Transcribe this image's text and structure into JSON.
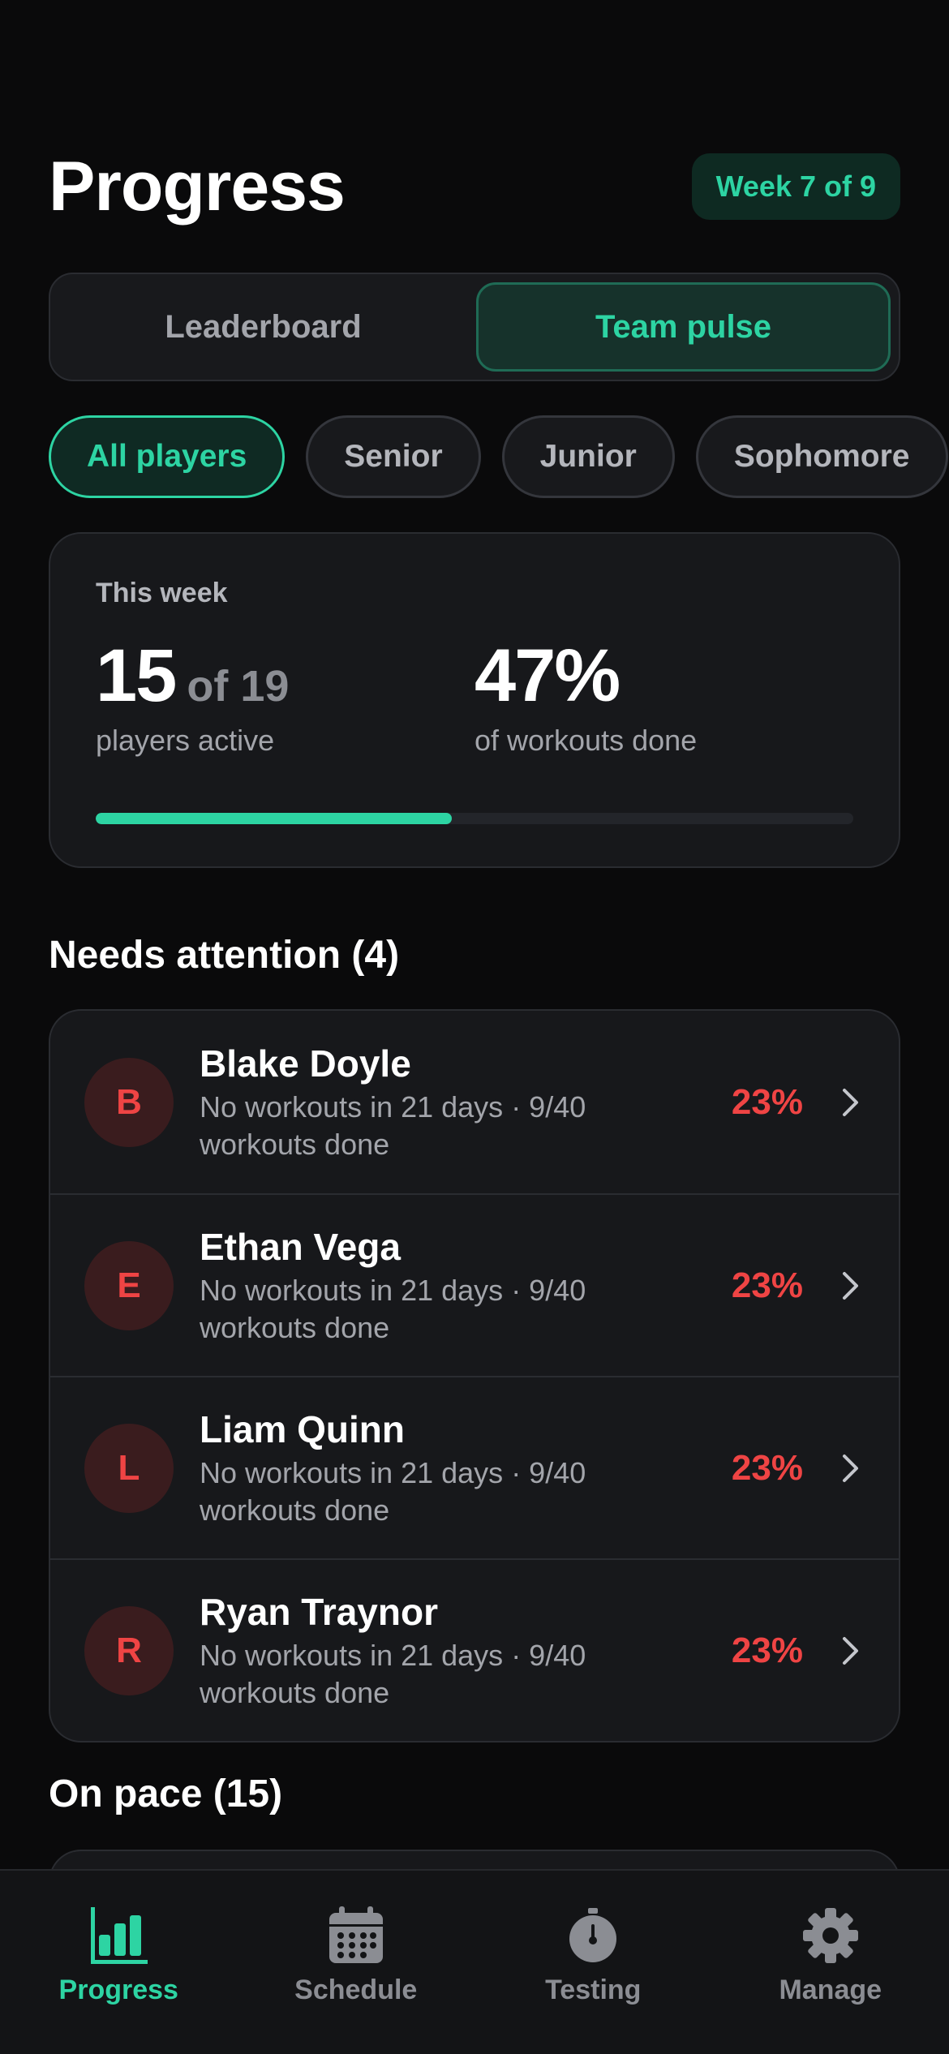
{
  "header": {
    "title": "Progress",
    "week_badge": "Week 7 of 9"
  },
  "segments": {
    "items": [
      {
        "label": "Leaderboard",
        "active": false
      },
      {
        "label": "Team pulse",
        "active": true
      }
    ]
  },
  "filters": {
    "chips": [
      {
        "label": "All players",
        "active": true
      },
      {
        "label": "Senior",
        "active": false
      },
      {
        "label": "Junior",
        "active": false
      },
      {
        "label": "Sophomore",
        "active": false
      }
    ]
  },
  "summary": {
    "label": "This week",
    "active_count": "15",
    "active_total": "of 19",
    "active_caption": "players active",
    "workouts_pct": "47%",
    "workouts_caption": "of workouts done",
    "progress_fraction": 0.47
  },
  "needs_attention": {
    "title": "Needs attention (4)",
    "players": [
      {
        "initial": "B",
        "name": "Blake Doyle",
        "detail": "No workouts in 21 days · 9/40 workouts done",
        "pct": "23%"
      },
      {
        "initial": "E",
        "name": "Ethan Vega",
        "detail": "No workouts in 21 days · 9/40 workouts done",
        "pct": "23%"
      },
      {
        "initial": "L",
        "name": "Liam Quinn",
        "detail": "No workouts in 21 days · 9/40 workouts done",
        "pct": "23%"
      },
      {
        "initial": "R",
        "name": "Ryan Traynor",
        "detail": "No workouts in 21 days · 9/40 workouts done",
        "pct": "23%"
      }
    ]
  },
  "on_pace": {
    "title": "On pace (15)"
  },
  "tabbar": {
    "items": [
      {
        "label": "Progress",
        "icon": "bar-chart-icon",
        "active": true
      },
      {
        "label": "Schedule",
        "icon": "calendar-icon",
        "active": false
      },
      {
        "label": "Testing",
        "icon": "stopwatch-icon",
        "active": false
      },
      {
        "label": "Manage",
        "icon": "gear-icon",
        "active": false
      }
    ]
  },
  "colors": {
    "accent": "#2dd4a3",
    "alert": "#ef4444",
    "background": "#0a0a0b"
  }
}
